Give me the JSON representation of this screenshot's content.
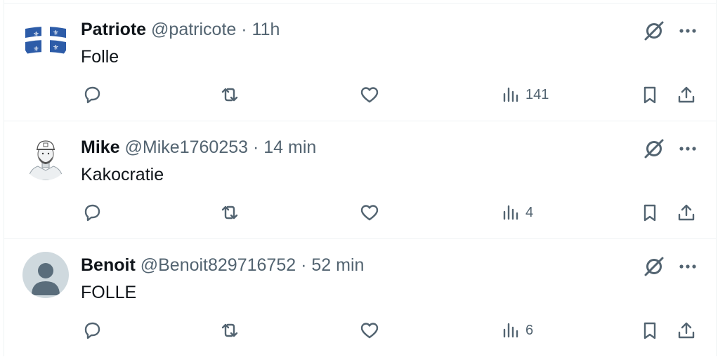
{
  "tweets": [
    {
      "name": "Patriote",
      "handle": "@patricote",
      "separator": "·",
      "time": "11h",
      "text": "Folle",
      "views": "141",
      "avatar": "quebec-flag"
    },
    {
      "name": "Mike",
      "handle": "@Mike1760253",
      "separator": "·",
      "time": "14 min",
      "text": "Kakocratie",
      "views": "4",
      "avatar": "sketch-portrait"
    },
    {
      "name": "Benoit",
      "handle": "@Benoit829716752",
      "separator": "·",
      "time": "52 min",
      "text": "FOLLE",
      "views": "6",
      "avatar": "default-silhouette"
    }
  ],
  "colors": {
    "text": "#0f1419",
    "secondary": "#536471",
    "divider": "#eff3f4",
    "flag_blue": "#2d5ca8",
    "default_avatar_bg": "#cfd9de",
    "default_avatar_fg": "#5a6d7b"
  }
}
